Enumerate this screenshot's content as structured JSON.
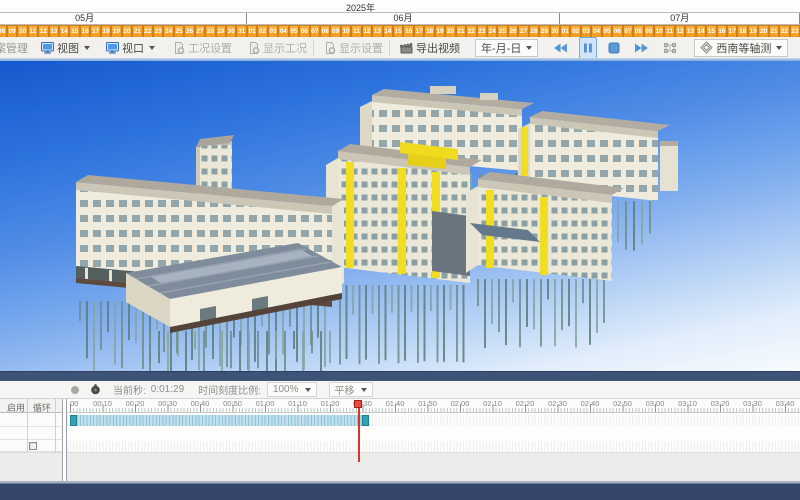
{
  "colors": {
    "accent_blue": "#4f8fd4",
    "day_cell_orange": "#f5a42c",
    "day_cell_border": "#d07d16",
    "yellow_accent": "#f2de20",
    "navy_bar": "#35466a",
    "clip_bar_blue": "#bfe0ec",
    "clip_handle_teal": "#35a2b2",
    "playhead_red": "#d8362a",
    "sky_top": "#1559cf",
    "sky_bottom": "#f7fbff"
  },
  "gantt": {
    "year": "2025年",
    "months": [
      {
        "label": "05月",
        "days": [
          "08",
          "09",
          "10",
          "11",
          "12",
          "13",
          "14",
          "15",
          "16",
          "17",
          "18",
          "19",
          "20",
          "21",
          "22",
          "23",
          "24",
          "25",
          "26",
          "27",
          "28",
          "29",
          "30",
          "31"
        ],
        "hidden_leading_days": 7
      },
      {
        "label": "06月",
        "days": [
          "01",
          "02",
          "03",
          "04",
          "05",
          "06",
          "07",
          "08",
          "09",
          "10",
          "11",
          "12",
          "13",
          "14",
          "15",
          "16",
          "17",
          "18",
          "19",
          "20",
          "21",
          "22",
          "23",
          "24",
          "25",
          "26",
          "27",
          "28",
          "29",
          "30"
        ],
        "hidden_leading_days": 0
      },
      {
        "label": "07月",
        "days": [
          "01",
          "02",
          "03",
          "04",
          "05",
          "06",
          "07",
          "08",
          "09",
          "10",
          "11",
          "12",
          "13",
          "14",
          "15",
          "16",
          "17",
          "18",
          "19",
          "20",
          "21",
          "22",
          "23"
        ],
        "hidden_leading_days": 0
      }
    ]
  },
  "toolbar": {
    "items": [
      {
        "type": "label",
        "name": "plan-management-label",
        "label": "方案管理",
        "gap": -16
      },
      {
        "type": "button",
        "name": "view-button",
        "icon": "monitor-icon",
        "label": "视图",
        "caret": true,
        "gap": 10
      },
      {
        "type": "button",
        "name": "viewport-button",
        "icon": "monitor-icon",
        "label": "视口",
        "caret": true,
        "gap": 10
      },
      {
        "type": "button",
        "name": "work-condition-settings-button",
        "icon": "doc-gear-icon",
        "label": "工况设置",
        "disabled": true,
        "gap": 12
      },
      {
        "type": "button",
        "name": "show-work-condition-button",
        "icon": "doc-gear-icon",
        "label": "显示工况",
        "disabled": true,
        "gap": 10
      },
      {
        "type": "sep"
      },
      {
        "type": "button",
        "name": "display-settings-button",
        "icon": "doc-gear-icon",
        "label": "显示设置",
        "disabled": true,
        "gap": 4
      },
      {
        "type": "sep"
      },
      {
        "type": "button",
        "name": "export-video-button",
        "icon": "clapperboard-icon",
        "label": "导出视频",
        "gap": 4
      },
      {
        "type": "combo",
        "name": "date-format-combo",
        "label": "年-月-日",
        "gap": 12
      },
      {
        "type": "icon",
        "name": "rewind-button",
        "icon": "rewind-icon",
        "gap": 12
      },
      {
        "type": "icon",
        "name": "pause-button",
        "icon": "pause-icon",
        "active": true,
        "gap": 8
      },
      {
        "type": "icon",
        "name": "stop-button",
        "icon": "stop-icon",
        "gap": 8
      },
      {
        "type": "icon",
        "name": "fast-forward-button",
        "icon": "fast-forward-icon",
        "gap": 8
      },
      {
        "type": "icon",
        "name": "align-grid-button",
        "icon": "nodes-icon",
        "disabled": true,
        "gap": 8
      },
      {
        "type": "combo",
        "name": "view-direction-combo",
        "icon": "cube-icon",
        "label": "西南等轴测",
        "gap": 14
      },
      {
        "type": "icon",
        "name": "snapshot-button",
        "icon": "image-icon",
        "disabled": true,
        "gap": 12
      },
      {
        "type": "icon",
        "name": "measure-button",
        "icon": "ruler-icon",
        "caret": true,
        "disabled": true,
        "gap": 10
      },
      {
        "type": "icon",
        "name": "section-button",
        "icon": "section-icon",
        "disabled": true,
        "gap": 8
      },
      {
        "type": "icon",
        "name": "grid-button",
        "icon": "grid-icon",
        "disabled": true,
        "gap": 10
      }
    ]
  },
  "viewport": {
    "view_name": "西南等轴测"
  },
  "timeline": {
    "controls": {
      "record_icon": "record-icon",
      "stopwatch_icon": "stopwatch-icon",
      "current_label": "当前秒:",
      "current_value": "0:01:29",
      "scale_label": "时间刻度比例:",
      "scale_value": "100%",
      "pan_label": "平移"
    },
    "columns": {
      "enable": "启用",
      "loop": "循环"
    },
    "ruler_labels": [
      "00",
      "00:10",
      "00:20",
      "00:30",
      "00:40",
      "00:50",
      "01:00",
      "01:10",
      "01:20",
      "01:30",
      "01:40",
      "01:50",
      "02:00",
      "02:10",
      "02:20",
      "02:30",
      "02:40",
      "02:50",
      "03:00",
      "03:10",
      "03:20",
      "03:30",
      "03:40"
    ],
    "clip": {
      "start": "0:00",
      "end": "0:01:30"
    }
  }
}
